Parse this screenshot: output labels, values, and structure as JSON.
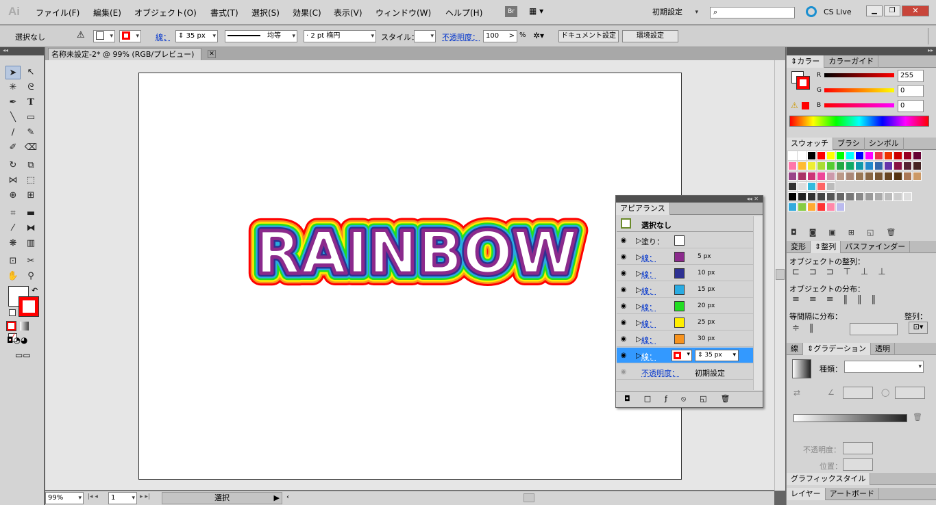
{
  "menubar": {
    "logo": "Ai",
    "items": [
      "ファイル(F)",
      "編集(E)",
      "オブジェクト(O)",
      "書式(T)",
      "選択(S)",
      "効果(C)",
      "表示(V)",
      "ウィンドウ(W)",
      "ヘルプ(H)"
    ],
    "bridge": "Br",
    "workspace": "初期設定",
    "cslive": "CS Live"
  },
  "control": {
    "selection": "選択なし",
    "stroke_label": "線：",
    "stroke_width": "35 px",
    "profile": "均等",
    "brush": "2 pt 楕円",
    "style_label": "スタイル：",
    "opacity_label": "不透明度：",
    "opacity": "100",
    "percent": "%",
    "doc_setup": "ドキュメント設定",
    "prefs": "環境設定"
  },
  "doc": {
    "tab": "名称未設定-2* @ 99% (RGB/プレビュー)",
    "zoom": "99%",
    "page": "1",
    "status": "選択",
    "art_text": "RAINBOW"
  },
  "color_panel": {
    "tabs": [
      "カラー",
      "カラーガイド"
    ],
    "r_label": "R",
    "g_label": "G",
    "b_label": "B",
    "r": "255",
    "g": "0",
    "b": "0"
  },
  "swatch_panel": {
    "tabs": [
      "スウォッチ",
      "ブラシ",
      "シンボル"
    ]
  },
  "align_panel": {
    "tabs": [
      "変形",
      "整列",
      "パスファインダー"
    ],
    "align_objects": "オブジェクトの整列：",
    "distribute_objects": "オブジェクトの分布：",
    "distribute_spacing": "等間隔に分布：",
    "align_to": "整列："
  },
  "gradient_panel": {
    "tabs": [
      "線",
      "グラデーション",
      "透明"
    ],
    "type_label": "種類：",
    "opacity_label": "不透明度：",
    "position_label": "位置："
  },
  "bottom_panels": {
    "graphic_styles": "グラフィックスタイル",
    "layers": "レイヤー",
    "artboards": "アートボード"
  },
  "appearance": {
    "title": "アピアランス",
    "header": "選択なし",
    "fill_label": "塗り：",
    "stroke_label": "線：",
    "opacity_label": "不透明度：",
    "opacity_value": "初期設定",
    "strokes": [
      {
        "color": "#8b2a8c",
        "width": "5 px"
      },
      {
        "color": "#2e3192",
        "width": "10 px"
      },
      {
        "color": "#29abe2",
        "width": "15 px"
      },
      {
        "color": "#22dd22",
        "width": "20 px"
      },
      {
        "color": "#ffee00",
        "width": "25 px"
      },
      {
        "color": "#f7931e",
        "width": "30 px"
      }
    ],
    "last_stroke_width": "35 px"
  },
  "colors": {
    "accent": "#3399ff",
    "stroke_red": "#ff0000"
  }
}
